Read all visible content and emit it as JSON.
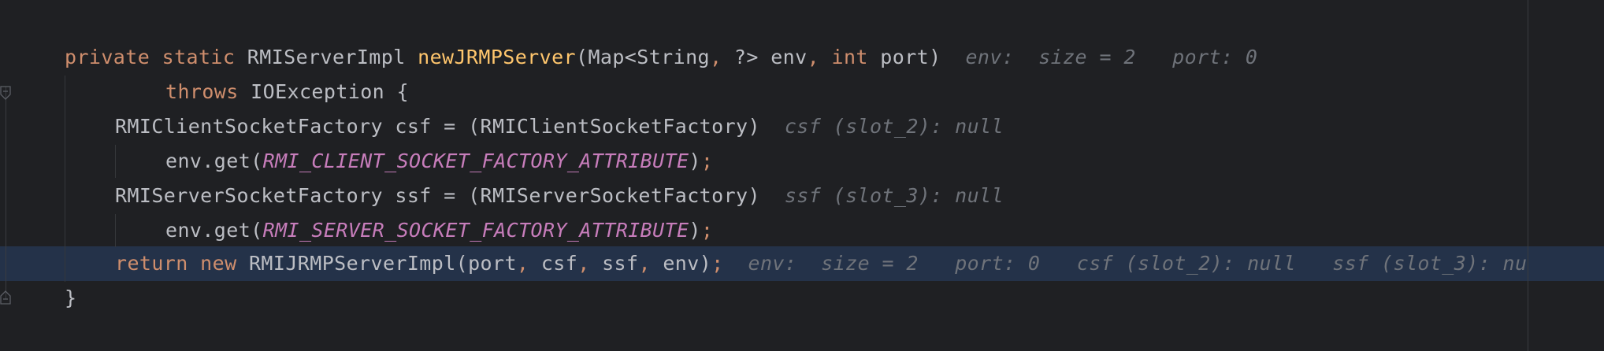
{
  "code": {
    "line1": {
      "kw_private": "private",
      "kw_static": "static",
      "type": "RMIServerImpl",
      "method": "newJRMPServer",
      "open": "(",
      "param1_type": "Map<String",
      "comma1": ",",
      "param1_wild": " ?> env",
      "comma2": ",",
      "kw_int": "int",
      "param2": " port)",
      "hint1": "env:  size = 2",
      "hint2": "port: 0"
    },
    "line2": {
      "kw_throws": "throws",
      "exception": " IOException {"
    },
    "line3": {
      "text": "RMIClientSocketFactory csf = (RMIClientSocketFactory)",
      "hint": "csf (slot_2): null"
    },
    "line4": {
      "prefix": "env.get(",
      "const": "RMI_CLIENT_SOCKET_FACTORY_ATTRIBUTE",
      "close": ")",
      "semi": ";"
    },
    "line5": {
      "text": "RMIServerSocketFactory ssf = (RMIServerSocketFactory)",
      "hint": "ssf (slot_3): null"
    },
    "line6": {
      "prefix": "env.get(",
      "const": "RMI_SERVER_SOCKET_FACTORY_ATTRIBUTE",
      "close": ")",
      "semi": ";"
    },
    "line7": {
      "kw_return": "return",
      "kw_new": "new",
      "call": " RMIJRMPServerImpl(port",
      "c1": ",",
      "a2": " csf",
      "c2": ",",
      "a3": " ssf",
      "c3": ",",
      "a4": " env)",
      "semi": ";",
      "hint1": "env:  size = 2",
      "hint2": "port: 0",
      "hint3": "csf (slot_2): null",
      "hint4": "ssf (slot_3): nu"
    },
    "line8": {
      "brace": "}"
    }
  },
  "colors": {
    "background": "#1f2023",
    "keyword": "#cf8e6d",
    "method_decl": "#ffc66d",
    "constant": "#c77dbb",
    "text": "#bcbec4",
    "hint": "#6f737a",
    "current_line": "#243249"
  }
}
